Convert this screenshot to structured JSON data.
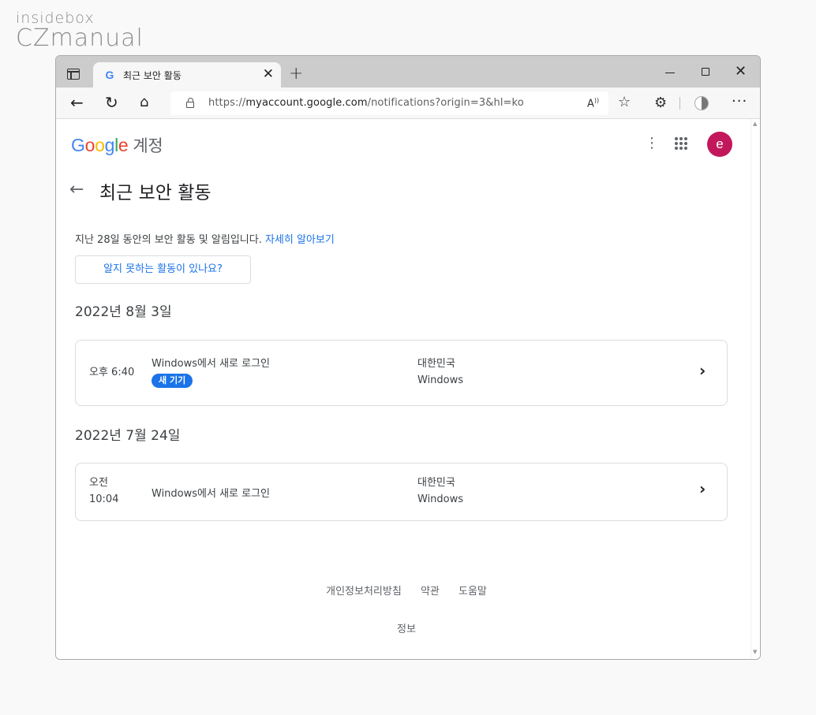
{
  "watermark": {
    "line1": "insidebox",
    "line2": "CZmanual"
  },
  "tab": {
    "title": "최근 보안 활동",
    "favicon": "G"
  },
  "toolbar": {
    "url_prefix": "https://",
    "url_host": "myaccount.google.com",
    "url_path": "/notifications?origin=3&hl=ko",
    "read_aloud": "Ã"
  },
  "header": {
    "logo": [
      "G",
      "o",
      "o",
      "g",
      "l",
      "e"
    ],
    "account_label": "계정",
    "avatar_letter": "e"
  },
  "page": {
    "title": "최근 보안 활동",
    "intro_text": "지난 28일 동안의 보안 활동 및 알림입니다. ",
    "learn_more": "자세히 알아보기",
    "unknown_activity_button": "알지 못하는 활동이 있나요?"
  },
  "activity_groups": [
    {
      "date": "2022년 8월 3일",
      "events": [
        {
          "time_line1": "오후 6:40",
          "time_line2": "",
          "event": "Windows에서 새로 로그인",
          "badge": "새 기기",
          "country": "대한민국",
          "os": "Windows"
        }
      ]
    },
    {
      "date": "2022년 7월 24일",
      "events": [
        {
          "time_line1": "오전",
          "time_line2": "10:04",
          "event": "Windows에서 새로 로그인",
          "badge": "",
          "country": "대한민국",
          "os": "Windows"
        }
      ]
    }
  ],
  "footer": {
    "privacy": "개인정보처리방침",
    "terms": "약관",
    "help": "도움말",
    "about": "정보"
  },
  "colors": {
    "link": "#1a73e8",
    "avatar": "#c2185b",
    "badge": "#1a73e8"
  }
}
